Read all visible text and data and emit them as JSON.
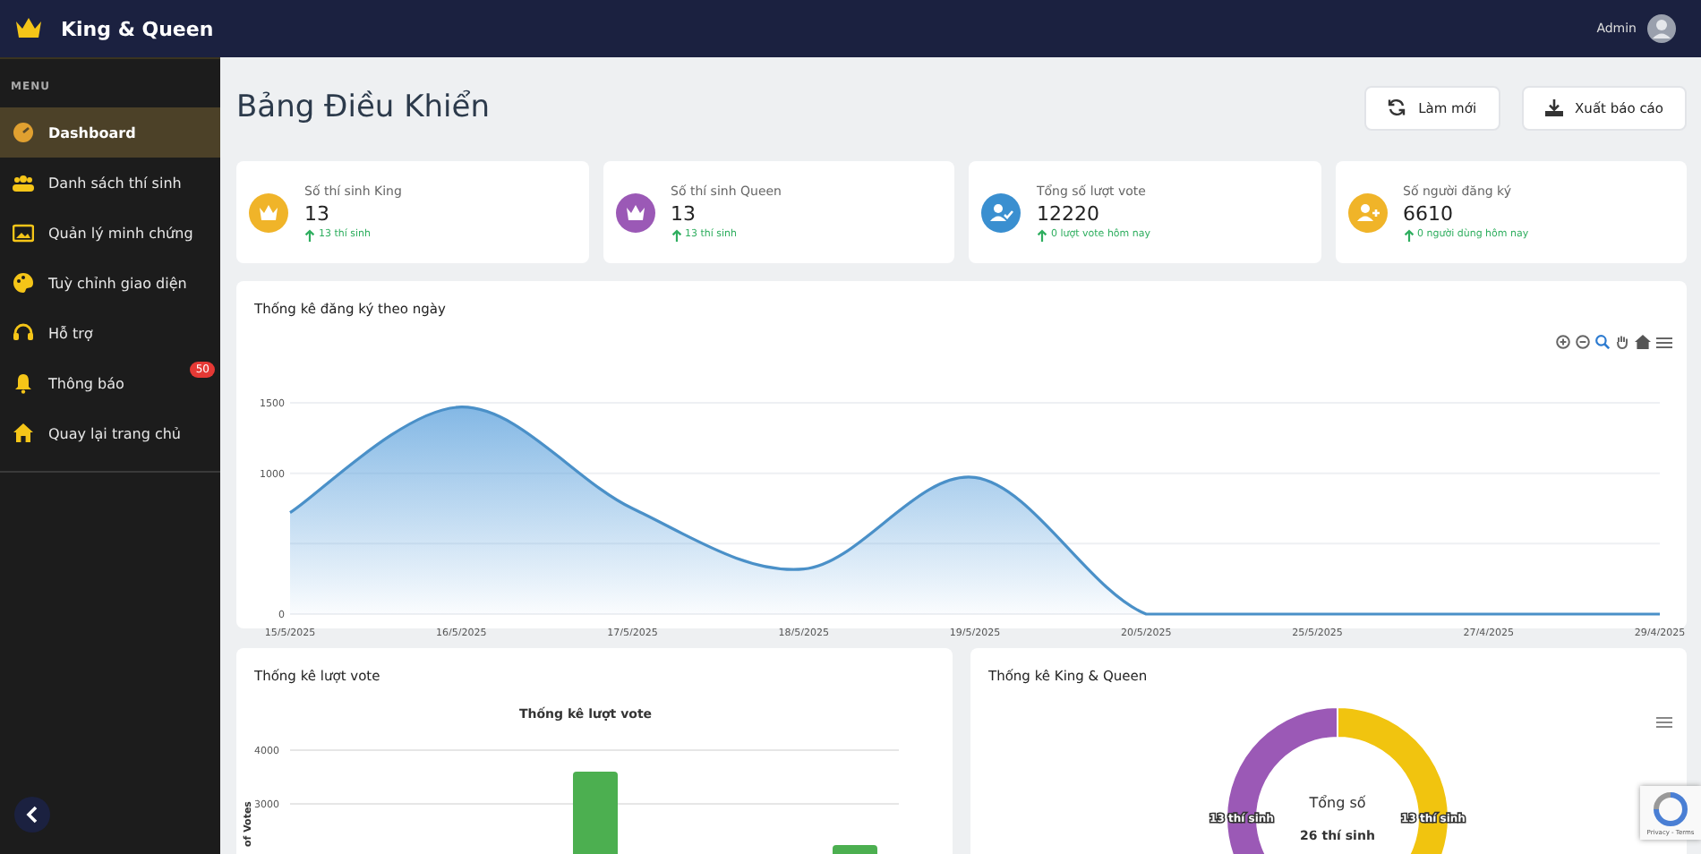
{
  "topbar": {
    "brand": "King & Queen",
    "user": "Admin"
  },
  "sidebar": {
    "heading": "MENU",
    "items": [
      {
        "label": "Dashboard",
        "selected": true
      },
      {
        "label": "Danh sách thí sinh",
        "selected": false
      },
      {
        "label": "Quản lý minh chứng",
        "selected": false
      },
      {
        "label": "Tuỳ chỉnh giao diện",
        "selected": false
      },
      {
        "label": "Hỗ trợ",
        "selected": false
      },
      {
        "label": "Thông báo",
        "selected": false,
        "badge": "50"
      },
      {
        "label": "Quay lại trang chủ",
        "selected": false
      }
    ]
  },
  "page": {
    "title": "Bảng Điều Khiển",
    "buttons": [
      {
        "label": "Làm mới"
      },
      {
        "label": "Xuất báo cáo"
      }
    ]
  },
  "stats": [
    {
      "label": "Số thí sinh King",
      "value": "13",
      "note": "13 thí sinh",
      "color": "#f0b429"
    },
    {
      "label": "Số thí sinh Queen",
      "value": "13",
      "note": "13 thí sinh",
      "color": "#9b59b6"
    },
    {
      "label": "Tổng số lượt vote",
      "value": "12220",
      "note": "0 lượt vote hôm nay",
      "color": "#3a8fd0"
    },
    {
      "label": "Số người đăng ký",
      "value": "6610",
      "note": "0 người dùng hôm nay",
      "color": "#f0b429"
    }
  ],
  "registration_card": {
    "title": "Thống kê đăng ký theo ngày",
    "chart_data": {
      "type": "area",
      "categories": [
        "15/5/2025",
        "16/5/2025",
        "17/5/2025",
        "18/5/2025",
        "19/5/2025",
        "20/5/2025",
        "25/5/2025",
        "27/4/2025",
        "29/4/2025"
      ],
      "series": [
        {
          "color": "#4a90c8",
          "values": [
            720,
            1470,
            750,
            320,
            970,
            0,
            0,
            0,
            0
          ]
        }
      ],
      "ylim": [
        0,
        1500
      ],
      "yticks": [
        0,
        1000,
        1500
      ]
    }
  },
  "vote_card": {
    "title": "Thống kê lượt vote",
    "chart_title": "Thống kê lượt vote",
    "axis_title": "of Votes",
    "tick_labels": [
      "4000",
      "3000"
    ]
  },
  "kq_card": {
    "title": "Thống kê King & Queen",
    "center_label": "Tổng số",
    "center_value": "26 thí sinh",
    "chart_data": {
      "type": "donut",
      "values": [
        13,
        13
      ],
      "value_labels": [
        "13 thí sinh",
        "13 thí sinh"
      ]
    }
  },
  "recaptcha": {
    "text": "Privacy - Terms"
  }
}
